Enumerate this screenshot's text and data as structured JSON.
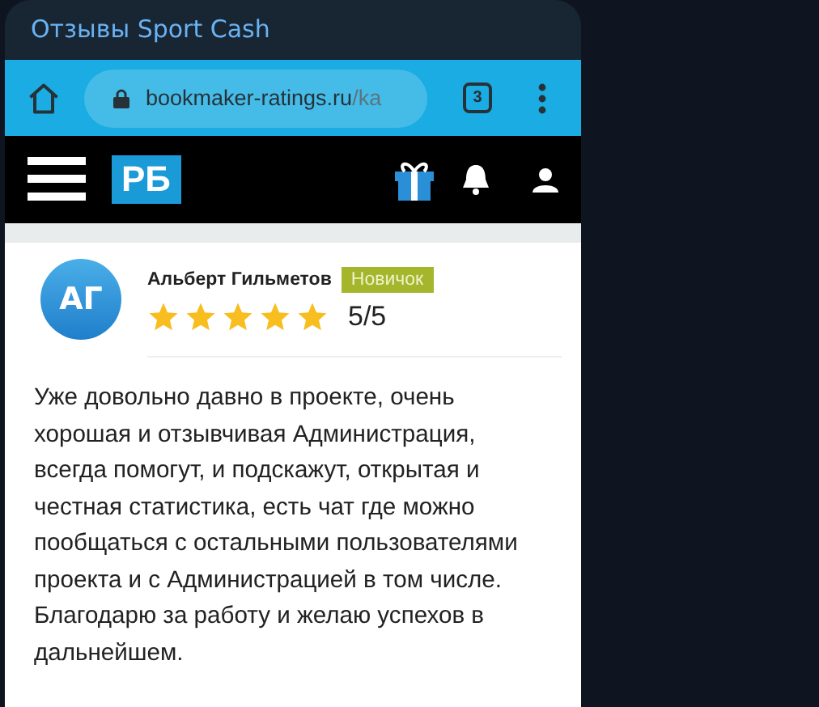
{
  "message": {
    "title": "Отзывы Sport Cash"
  },
  "browser": {
    "url_host": "bookmaker-ratings.ru",
    "url_path": "/ka",
    "tab_count": "3"
  },
  "site_header": {
    "logo": "РБ"
  },
  "review": {
    "initials": "АГ",
    "author": "Альберт Гильметов",
    "badge": "Новичок",
    "stars": 5,
    "score": "5/5",
    "text": "Уже довольно давно в проекте, очень хорошая и отзывчивая Администрация, всегда помогут, и подскажут, открытая и честная статистика, есть чат где можно пообщаться с остальными пользователями проекта и с Администрацией в том числе. Благодарю за работу и желаю успехов в дальнейшем."
  }
}
